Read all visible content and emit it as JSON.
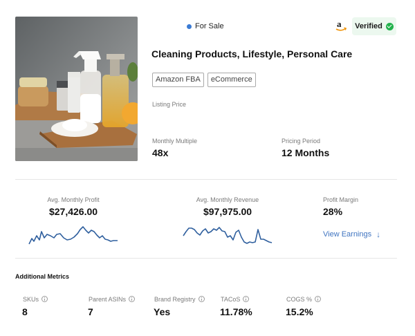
{
  "listing": {
    "status": "For Sale",
    "status_color": "#3b7bd4",
    "marketplace_icon": "amazon-logo-icon",
    "verified_label": "Verified",
    "verified_color": "#22b24c",
    "title": "Cleaning Products, Lifestyle, Personal Care",
    "tags": [
      "Amazon FBA",
      "eCommerce"
    ],
    "listing_price_label": "Listing Price",
    "monthly_multiple_label": "Monthly Multiple",
    "monthly_multiple_value": "48x",
    "pricing_period_label": "Pricing Period",
    "pricing_period_value": "12 Months"
  },
  "metrics": {
    "avg_monthly_profit_label": "Avg. Monthly Profit",
    "avg_monthly_profit_value": "$27,426.00",
    "avg_monthly_revenue_label": "Avg. Monthly Revenue",
    "avg_monthly_revenue_value": "$97,975.00",
    "profit_margin_label": "Profit Margin",
    "profit_margin_value": "28%",
    "view_earnings_label": "View Earnings",
    "view_earnings_icon": "arrow-down-icon",
    "sparkline_color": "#2f5f9e"
  },
  "additional": {
    "title": "Additional Metrics",
    "items": [
      {
        "label": "SKUs",
        "value": "8"
      },
      {
        "label": "Parent ASINs",
        "value": "7"
      },
      {
        "label": "Brand Registry",
        "value": "Yes"
      },
      {
        "label": "TACoS",
        "value": "11.78%"
      },
      {
        "label": "COGS %",
        "value": "15.2%"
      }
    ]
  }
}
